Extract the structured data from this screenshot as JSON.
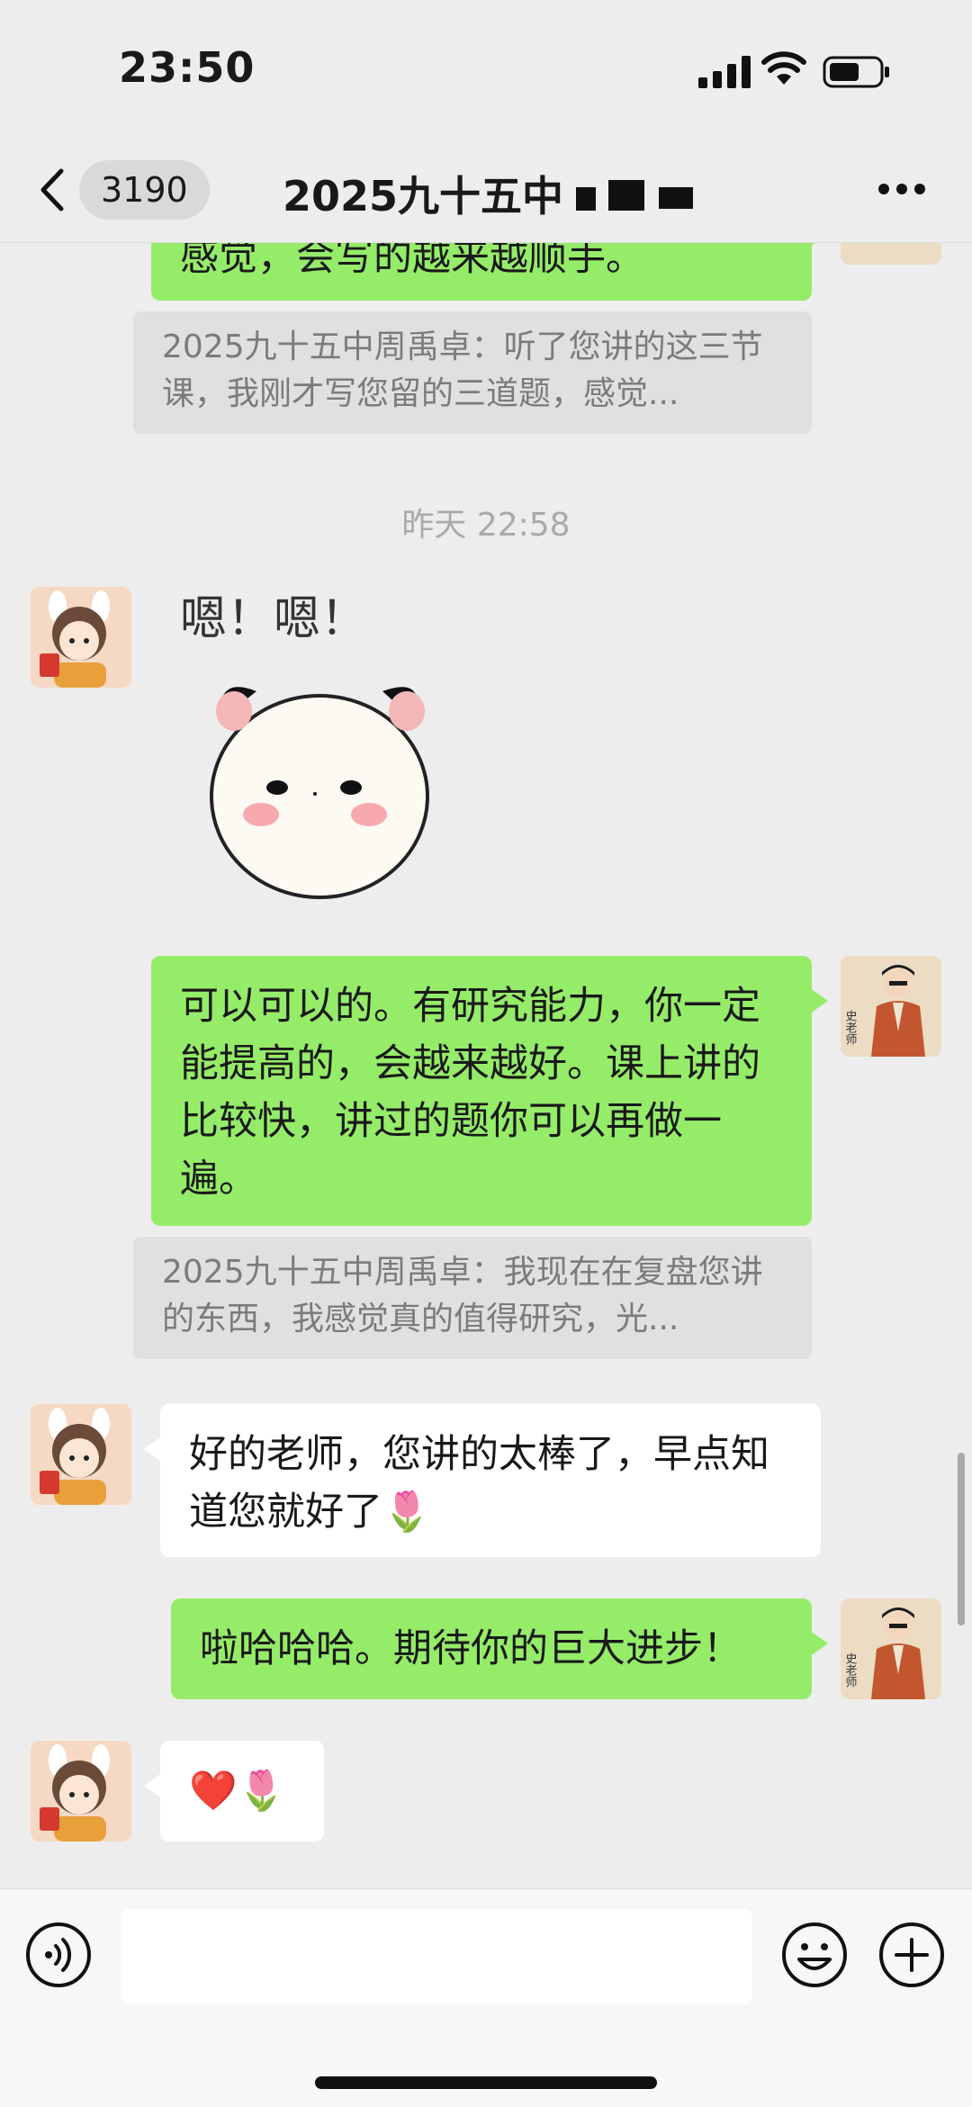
{
  "status_bar": {
    "time": "23:50"
  },
  "nav": {
    "unread_count": "3190",
    "title": "2025九十五中"
  },
  "messages": {
    "top_partial": "感觉，会写的越来越顺手。",
    "quote1": "2025九十五中周禹卓：听了您讲的这三节课，我刚才写您留的三道题，感觉...",
    "timestamp": "昨天 22:58",
    "sticker_text": "嗯！嗯！",
    "teacher_msg1": "可以可以的。有研究能力，你一定能提高的，会越来越好。课上讲的比较快，讲过的题你可以再做一遍。",
    "quote2": "2025九十五中周禹卓：我现在在复盘您讲的东西，我感觉真的值得研究，光...",
    "student_msg1": "好的老师，您讲的太棒了，早点知道您就好了🌷",
    "teacher_msg2": "啦哈哈哈。期待你的巨大进步！",
    "student_msg2": "❤️🌷"
  },
  "teacher_avatar_text": "史老师",
  "input": {
    "placeholder": ""
  },
  "colors": {
    "background": "#ededed",
    "sent_bubble": "#95ec69",
    "received_bubble": "#ffffff"
  }
}
